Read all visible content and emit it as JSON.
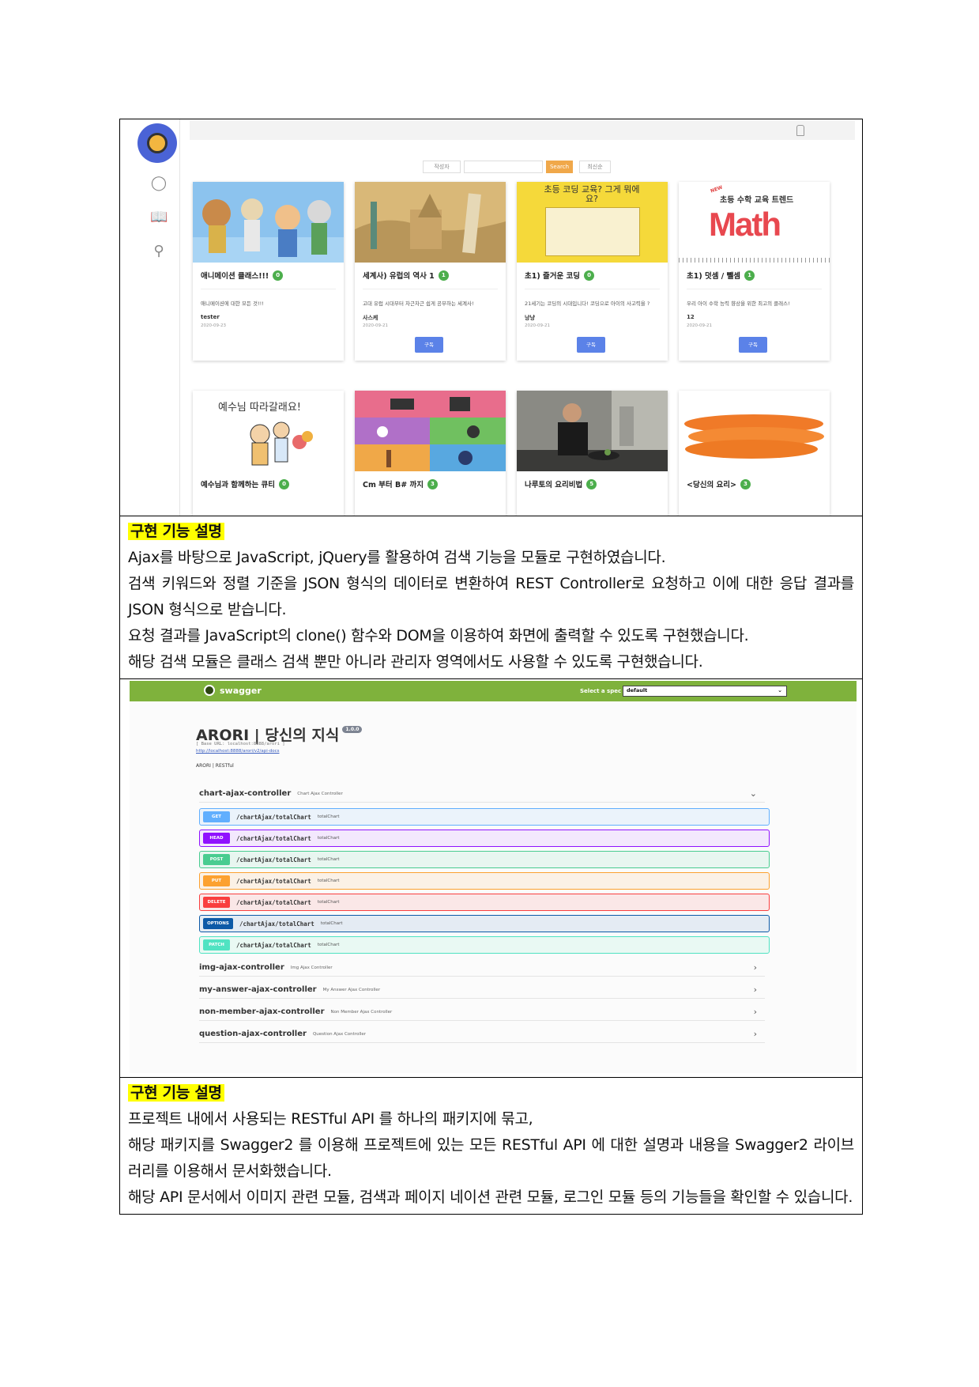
{
  "screenshot1": {
    "search": {
      "filter_label": "작성자",
      "search_button": "Search",
      "sort_label": "최신순"
    },
    "cards": [
      {
        "title": "애니메이션 클래스!!!",
        "badge": "0",
        "desc": "애니메이션에 대한 모든 것!!!",
        "author": "tester",
        "date": "2020-09-23",
        "button": ""
      },
      {
        "title": "세계사) 유럽의 역사 1",
        "badge": "1",
        "desc": "고대 유럽 시대부터 차근차근 쉽게 공부하는 세계사!",
        "author": "사스케",
        "date": "2020-09-21",
        "button": "구독"
      },
      {
        "title": "초1) 즐거운 코딩",
        "badge": "0",
        "desc": "21세기는 코딩의 시대입니다! 코딩으로 아이의 사고력을 ?",
        "author": "냥냥",
        "date": "2020-09-21",
        "button": "구독",
        "thumb_text": "초등 코딩 교육? 그게 뭐에요?"
      },
      {
        "title": "초1) 덧셈 / 뺄셈",
        "badge": "1",
        "desc": "우리 아이 수학 능력 향상을 위한 최고의 클래스!",
        "author": "12",
        "date": "2020-09-21",
        "button": "구독",
        "thumb_text": "초등 수학 교육 트렌드",
        "thumb_new": "NEW",
        "thumb_math": "Math"
      },
      {
        "title": "예수님과 함께하는 큐티",
        "badge": "0",
        "desc": "",
        "author": "",
        "date": "",
        "button": "",
        "thumb_text": "예수님 따라갈래요!"
      },
      {
        "title": "Cm 부터 B# 까지",
        "badge": "3",
        "desc": "",
        "author": "",
        "date": "",
        "button": ""
      },
      {
        "title": "나루토의 요리비법",
        "badge": "5",
        "desc": "",
        "author": "",
        "date": "",
        "button": ""
      },
      {
        "title": "<당신의 요리>",
        "badge": "3",
        "desc": "",
        "author": "",
        "date": "",
        "button": ""
      }
    ]
  },
  "section1": {
    "heading": "구현 기능 설명",
    "lines": [
      "Ajax를 바탕으로 JavaScript, jQuery를 활용하여 검색 기능을 모듈로 구현하였습니다.",
      "검색 키워드와 정렬 기준을 JSON 형식의 데이터로 변환하여 REST Controller로 요청하고 이에 대한 응답 결과를 JSON 형식으로 받습니다.",
      "요청 결과를 JavaScript의 clone() 함수와 DOM을 이용하여 화면에 출력할 수 있도록 구현했습니다.",
      "해당 검색 모듈은 클래스 검색 뿐만 아니라 관리자 영역에서도 사용할 수 있도록 구현했습니다."
    ]
  },
  "screenshot2": {
    "logo": "swagger",
    "spec_label": "Select a spec",
    "spec_value": "default",
    "title": "ARORI | 당신의 지식",
    "version": "1.0.0",
    "base_url": "[ Base URL: localhost:8888/arori ]",
    "docs_link": "http://localhost:8888/arori/v2/api-docs",
    "description": "ARORI | RESTful",
    "controllers": [
      {
        "name": "chart-ajax-controller",
        "sub": "Chart Ajax Controller",
        "arrow": "⌄"
      },
      {
        "name": "img-ajax-controller",
        "sub": "Img Ajax Controller",
        "arrow": "›"
      },
      {
        "name": "my-answer-ajax-controller",
        "sub": "My Answer Ajax Controller",
        "arrow": "›"
      },
      {
        "name": "non-member-ajax-controller",
        "sub": "Non Member Ajax Controller",
        "arrow": "›"
      },
      {
        "name": "question-ajax-controller",
        "sub": "Question Ajax Controller",
        "arrow": "›"
      }
    ],
    "operations": [
      {
        "method": "GET",
        "path": "/chartAjax/totalChart",
        "desc": "totalChart",
        "color": "#61affe",
        "bg": "#ebf3fb"
      },
      {
        "method": "HEAD",
        "path": "/chartAjax/totalChart",
        "desc": "totalChart",
        "color": "#9012fe",
        "bg": "#f3e8fd"
      },
      {
        "method": "POST",
        "path": "/chartAjax/totalChart",
        "desc": "totalChart",
        "color": "#49cc90",
        "bg": "#e8f6f0"
      },
      {
        "method": "PUT",
        "path": "/chartAjax/totalChart",
        "desc": "totalChart",
        "color": "#fca130",
        "bg": "#fbf1e6"
      },
      {
        "method": "DELETE",
        "path": "/chartAjax/totalChart",
        "desc": "totalChart",
        "color": "#f93e3e",
        "bg": "#fae7e7"
      },
      {
        "method": "OPTIONS",
        "path": "/chartAjax/totalChart",
        "desc": "totalChart",
        "color": "#0d5aa7",
        "bg": "#e4ebf3"
      },
      {
        "method": "PATCH",
        "path": "/chartAjax/totalChart",
        "desc": "totalChart",
        "color": "#50e3c2",
        "bg": "#e9f9f3"
      }
    ]
  },
  "section2": {
    "heading": "구현 기능 설명",
    "lines": [
      "프로젝트 내에서 사용되는 RESTful API 를 하나의 패키지에 묶고,",
      "해당 패키지를 Swagger2 를 이용해 프로젝트에 있는 모든 RESTful API 에 대한 설명과 내용을 Swagger2 라이브러리를 이용해서 문서화했습니다.",
      "해당 API 문서에서 이미지 관련 모듈, 검색과 페이지 네이션 관련 모듈, 로그인 모듈 등의 기능들을 확인할 수 있습니다."
    ]
  }
}
